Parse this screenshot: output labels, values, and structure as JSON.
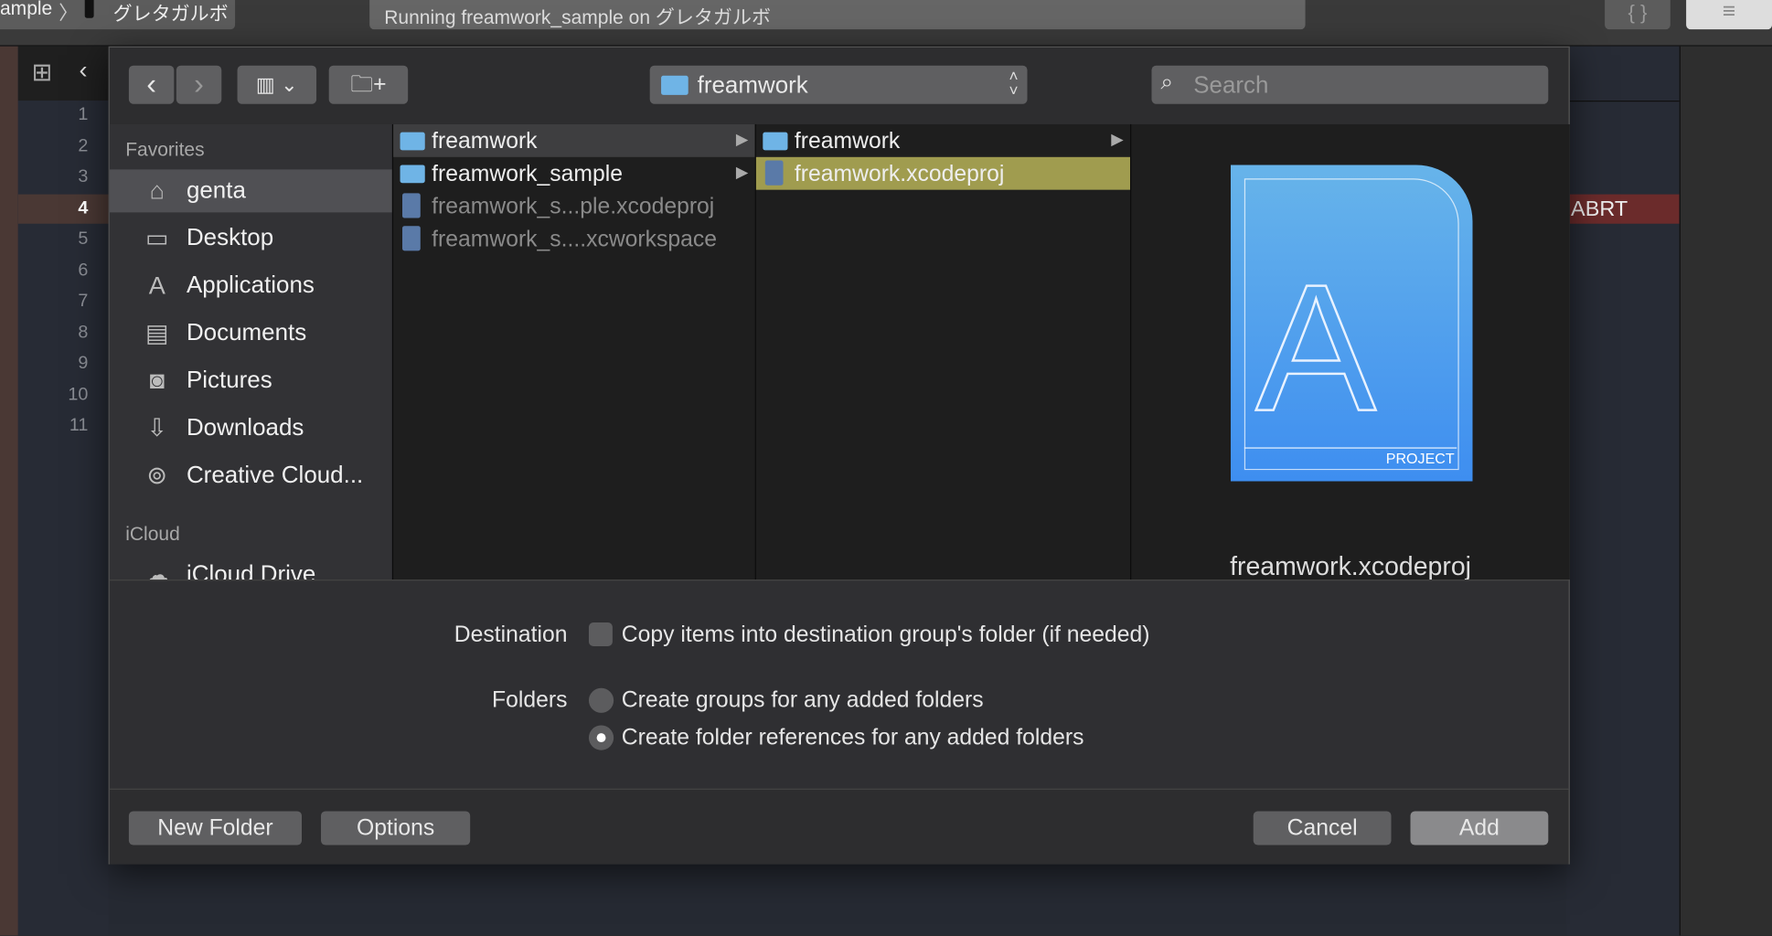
{
  "toolbar": {
    "scheme_partial": "ample",
    "device": "グレタガルボ",
    "status": "Running freamwork_sample on グレタガルボ"
  },
  "gutter": {
    "lines": [
      "1",
      "2",
      "3",
      "4",
      "5",
      "6",
      "7",
      "8",
      "9",
      "10",
      "11"
    ],
    "current_line": "4"
  },
  "editor": {
    "error_badge": "ABRT"
  },
  "dialog": {
    "location": "freamwork",
    "search_placeholder": "Search",
    "sidebar": {
      "favorites_header": "Favorites",
      "favorites": [
        {
          "label": "genta",
          "icon": "home-icon"
        },
        {
          "label": "Desktop",
          "icon": "desktop-icon"
        },
        {
          "label": "Applications",
          "icon": "applications-icon"
        },
        {
          "label": "Documents",
          "icon": "documents-icon"
        },
        {
          "label": "Pictures",
          "icon": "camera-icon"
        },
        {
          "label": "Downloads",
          "icon": "download-icon"
        },
        {
          "label": "Creative Cloud...",
          "icon": "creative-cloud-icon"
        }
      ],
      "icloud_header": "iCloud",
      "icloud": [
        {
          "label": "iCloud Drive",
          "icon": "cloud-icon"
        }
      ]
    },
    "column1": [
      {
        "name": "freamwork",
        "type": "folder",
        "selected": true
      },
      {
        "name": "freamwork_sample",
        "type": "folder"
      },
      {
        "name": "freamwork_s...ple.xcodeproj",
        "type": "xcodeproj",
        "disabled": true
      },
      {
        "name": "freamwork_s....xcworkspace",
        "type": "xcworkspace",
        "disabled": true
      }
    ],
    "column2": [
      {
        "name": "freamwork",
        "type": "folder"
      },
      {
        "name": "freamwork.xcodeproj",
        "type": "xcodeproj",
        "selected": true
      }
    ],
    "preview": {
      "badge": "PROJECT",
      "filename": "freamwork.xcodeproj"
    },
    "options": {
      "destination_label": "Destination",
      "copy_items": "Copy items into destination group's folder (if needed)",
      "copy_checked": false,
      "folders_label": "Folders",
      "folder_options": [
        "Create groups for any added folders",
        "Create folder references for any added folders"
      ],
      "folder_selected": 1
    },
    "buttons": {
      "new_folder": "New Folder",
      "options": "Options",
      "cancel": "Cancel",
      "add": "Add"
    }
  },
  "colors": {
    "selection": "#a09c4f",
    "error": "#6b2b2b",
    "accent": "#4a9ef0"
  }
}
